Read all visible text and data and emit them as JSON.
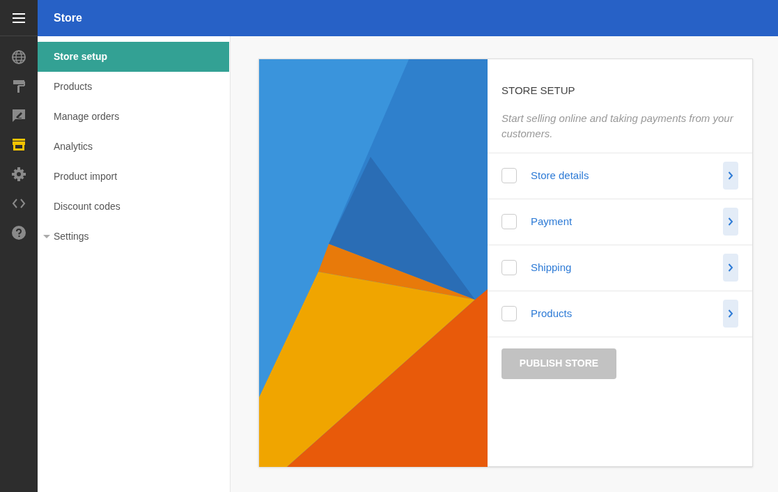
{
  "header": {
    "title": "Store"
  },
  "rail": [
    {
      "kind": "globe",
      "selected": false
    },
    {
      "kind": "roller",
      "selected": false
    },
    {
      "kind": "feedback",
      "selected": false
    },
    {
      "kind": "store",
      "selected": true
    },
    {
      "kind": "gear",
      "selected": false
    },
    {
      "kind": "code",
      "selected": false
    },
    {
      "kind": "help",
      "selected": false
    }
  ],
  "sidebar": {
    "items": [
      {
        "label": "Store setup",
        "selected": true,
        "expandable": false
      },
      {
        "label": "Products",
        "selected": false,
        "expandable": false
      },
      {
        "label": "Manage orders",
        "selected": false,
        "expandable": false
      },
      {
        "label": "Analytics",
        "selected": false,
        "expandable": false
      },
      {
        "label": "Product import",
        "selected": false,
        "expandable": false
      },
      {
        "label": "Discount codes",
        "selected": false,
        "expandable": false
      },
      {
        "label": "Settings",
        "selected": false,
        "expandable": true
      }
    ]
  },
  "card": {
    "title": "STORE SETUP",
    "subtitle": "Start selling online and taking payments from your customers.",
    "steps": [
      {
        "label": "Store details",
        "checked": false
      },
      {
        "label": "Payment",
        "checked": false
      },
      {
        "label": "Shipping",
        "checked": false
      },
      {
        "label": "Products",
        "checked": false
      }
    ],
    "publish_button": {
      "label": "PUBLISH STORE",
      "disabled": true
    }
  }
}
